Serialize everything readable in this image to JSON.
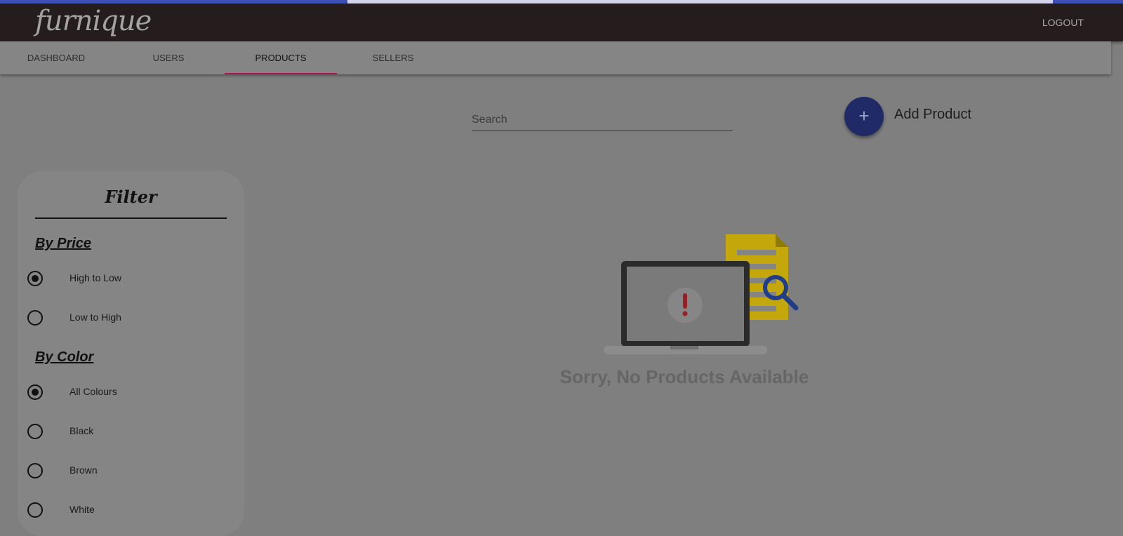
{
  "brand": "furnique",
  "header": {
    "logout_label": "LOGOUT"
  },
  "tabs": [
    {
      "label": "DASHBOARD"
    },
    {
      "label": "USERS"
    },
    {
      "label": "PRODUCTS",
      "active": true
    },
    {
      "label": "SELLERS"
    }
  ],
  "search": {
    "placeholder": "Search",
    "value": ""
  },
  "add_product": {
    "icon": "+",
    "label": "Add Product"
  },
  "filter": {
    "title": "Filter",
    "by_price": {
      "heading": "By Price",
      "options": [
        {
          "label": "High to Low",
          "checked": true
        },
        {
          "label": "Low to High",
          "checked": false
        }
      ]
    },
    "by_color": {
      "heading": "By Color",
      "options": [
        {
          "label": "All Colours",
          "checked": true
        },
        {
          "label": "Black",
          "checked": false
        },
        {
          "label": "Brown",
          "checked": false
        },
        {
          "label": "White",
          "checked": false
        }
      ]
    }
  },
  "empty_state": {
    "message": "Sorry, No Products Available"
  },
  "colors": {
    "header_bg": "#241c1d",
    "accent": "#3f51b5",
    "tab_indicator": "#b01552",
    "overlay_bg": "#7f7f7f"
  }
}
